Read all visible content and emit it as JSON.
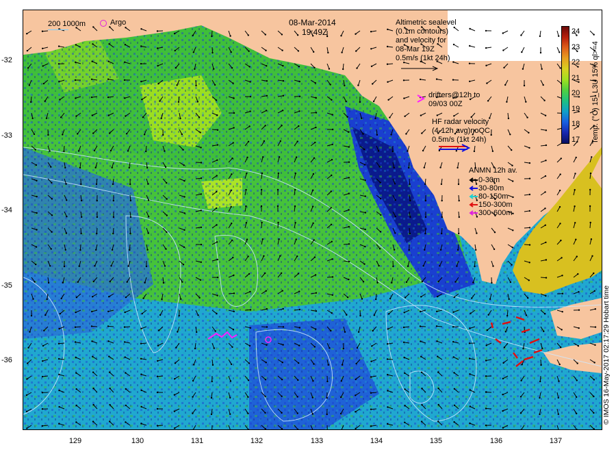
{
  "title": {
    "date": "08-Mar-2014",
    "time": "19:49Z"
  },
  "scale_legend": {
    "contour_label": "200  1000m",
    "argo_label": "Argo"
  },
  "altimetry_legend": {
    "lines": [
      "Altimetric sealevel",
      "(0.1m contours)",
      "and velocity for",
      "08-Mar 19Z",
      "0.5m/s (1kt 24h)"
    ]
  },
  "drifters_legend": {
    "lines": [
      "drifters@12h to",
      "09/03 00Z"
    ]
  },
  "hf_radar_legend": {
    "lines": [
      "HF radar velocity",
      "(4-12h avg)noQC",
      "0.5m/s (1kt 24h)"
    ]
  },
  "anmn_legend": {
    "title": "ANMN 12h av.",
    "items": [
      {
        "label": "0-30m",
        "color": "#000000"
      },
      {
        "label": "30-80m",
        "color": "#1010e0"
      },
      {
        "label": "80-150m",
        "color": "#20d0d0"
      },
      {
        "label": "150-300m",
        "color": "#e01010"
      },
      {
        "label": "300-600m",
        "color": "#e020e0"
      }
    ]
  },
  "axes": {
    "y_ticks": [
      "-32",
      "-33",
      "-34",
      "-35",
      "-36"
    ],
    "x_ticks": [
      "129",
      "130",
      "131",
      "132",
      "133",
      "134",
      "135",
      "136",
      "137"
    ]
  },
  "colorbar": {
    "ticks": [
      "24",
      "23",
      "22",
      "21",
      "20",
      "19",
      "18",
      "17"
    ],
    "title": "Temp. (°C) 15_L3U 15% ql>=4",
    "colors": [
      "#6b0a0a",
      "#b8200c",
      "#e0601a",
      "#e8a020",
      "#d8d020",
      "#a0e020",
      "#50d040",
      "#20c080",
      "#10a0c8",
      "#1860e0",
      "#1828b0",
      "#0a1060"
    ]
  },
  "credit": "© IMOS 16-May-2017 02:17:29 Hobart time",
  "colors": {
    "land": "#f7c59f",
    "warm_water": "#a6e21e",
    "mid_water": "#46c33a",
    "cool_water": "#1fa0d0",
    "cold_water": "#1a3fd0",
    "contour": "#cfe8ff",
    "drifter": "#ff20ff",
    "hf_radar_red": "#e01010",
    "hf_radar_blue": "#1010e0"
  }
}
